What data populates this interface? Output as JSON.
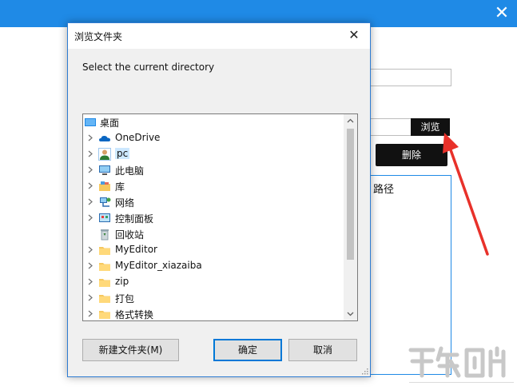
{
  "background_app": {
    "close_glyph": "✕",
    "browse_label": "浏览",
    "delete_label": "删除",
    "list_header": "路径",
    "accent_color": "#1f8ae6",
    "arrow_color": "#e8312a"
  },
  "dialog": {
    "title": "浏览文件夹",
    "close_glyph": "✕",
    "prompt": "Select the current directory",
    "tree": [
      {
        "label": "桌面",
        "icon": "desktop-icon",
        "has_chevron": false,
        "indent": 0,
        "selected": false
      },
      {
        "label": "OneDrive",
        "icon": "cloud-icon",
        "has_chevron": true,
        "indent": 1,
        "selected": false
      },
      {
        "label": "pc",
        "icon": "user-icon",
        "has_chevron": true,
        "indent": 1,
        "selected": true
      },
      {
        "label": "此电脑",
        "icon": "computer-icon",
        "has_chevron": true,
        "indent": 1,
        "selected": false
      },
      {
        "label": "库",
        "icon": "library-icon",
        "has_chevron": true,
        "indent": 1,
        "selected": false
      },
      {
        "label": "网络",
        "icon": "network-icon",
        "has_chevron": true,
        "indent": 1,
        "selected": false
      },
      {
        "label": "控制面板",
        "icon": "control-panel-icon",
        "has_chevron": true,
        "indent": 1,
        "selected": false
      },
      {
        "label": "回收站",
        "icon": "recycle-bin-icon",
        "has_chevron": false,
        "indent": 1,
        "selected": false
      },
      {
        "label": "MyEditor",
        "icon": "folder-icon",
        "has_chevron": true,
        "indent": 1,
        "selected": false
      },
      {
        "label": "MyEditor_xiazaiba",
        "icon": "folder-icon",
        "has_chevron": true,
        "indent": 1,
        "selected": false
      },
      {
        "label": "zip",
        "icon": "folder-icon",
        "has_chevron": true,
        "indent": 1,
        "selected": false
      },
      {
        "label": "打包",
        "icon": "folder-icon",
        "has_chevron": true,
        "indent": 1,
        "selected": false
      },
      {
        "label": "格式转换",
        "icon": "folder-icon",
        "has_chevron": true,
        "indent": 1,
        "selected": false
      }
    ],
    "buttons": {
      "new_folder": "新建文件夹(M)",
      "ok": "确定",
      "cancel": "取消"
    }
  }
}
